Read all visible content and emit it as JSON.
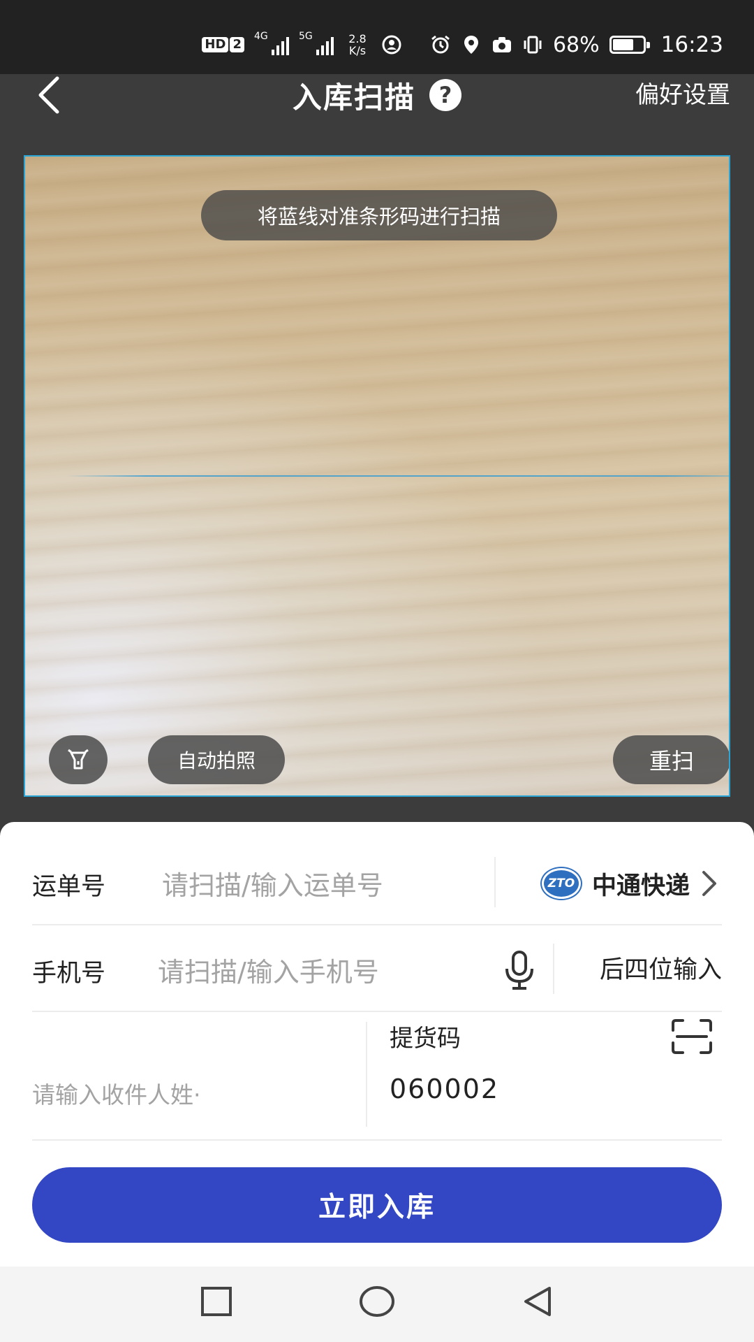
{
  "status_bar": {
    "hd": "HD",
    "sim": "2",
    "net1": "4G",
    "net2": "5G",
    "speed_value": "2.8",
    "speed_unit": "K/s",
    "battery_pct": "68%",
    "battery_level": 0.68,
    "time": "16:23"
  },
  "header": {
    "title": "入库扫描",
    "help": "?",
    "preferences": "偏好设置"
  },
  "scanner": {
    "hint": "将蓝线对准条形码进行扫描",
    "auto_photo": "自动拍照",
    "rescan": "重扫"
  },
  "form": {
    "waybill": {
      "label": "运单号",
      "placeholder": "请扫描/输入运单号",
      "carrier_logo": "ZTO",
      "carrier_name": "中通快递"
    },
    "phone": {
      "label": "手机号",
      "placeholder": "请扫描/输入手机号",
      "last_four": "后四位输入"
    },
    "recipient": {
      "placeholder": "请输入收件人姓·"
    },
    "pickup_code": {
      "label": "提货码",
      "value": "060002"
    },
    "submit": "立即入库"
  },
  "colors": {
    "accent": "#3346c4",
    "scan_line": "#2aa6d6"
  },
  "icons": {
    "back": "chevron-left-icon",
    "help": "question-circle-icon",
    "flash": "flashlight-icon",
    "mic": "microphone-icon",
    "scan": "scan-frame-icon",
    "nav": [
      "square-icon",
      "circle-icon",
      "triangle-back-icon"
    ]
  }
}
